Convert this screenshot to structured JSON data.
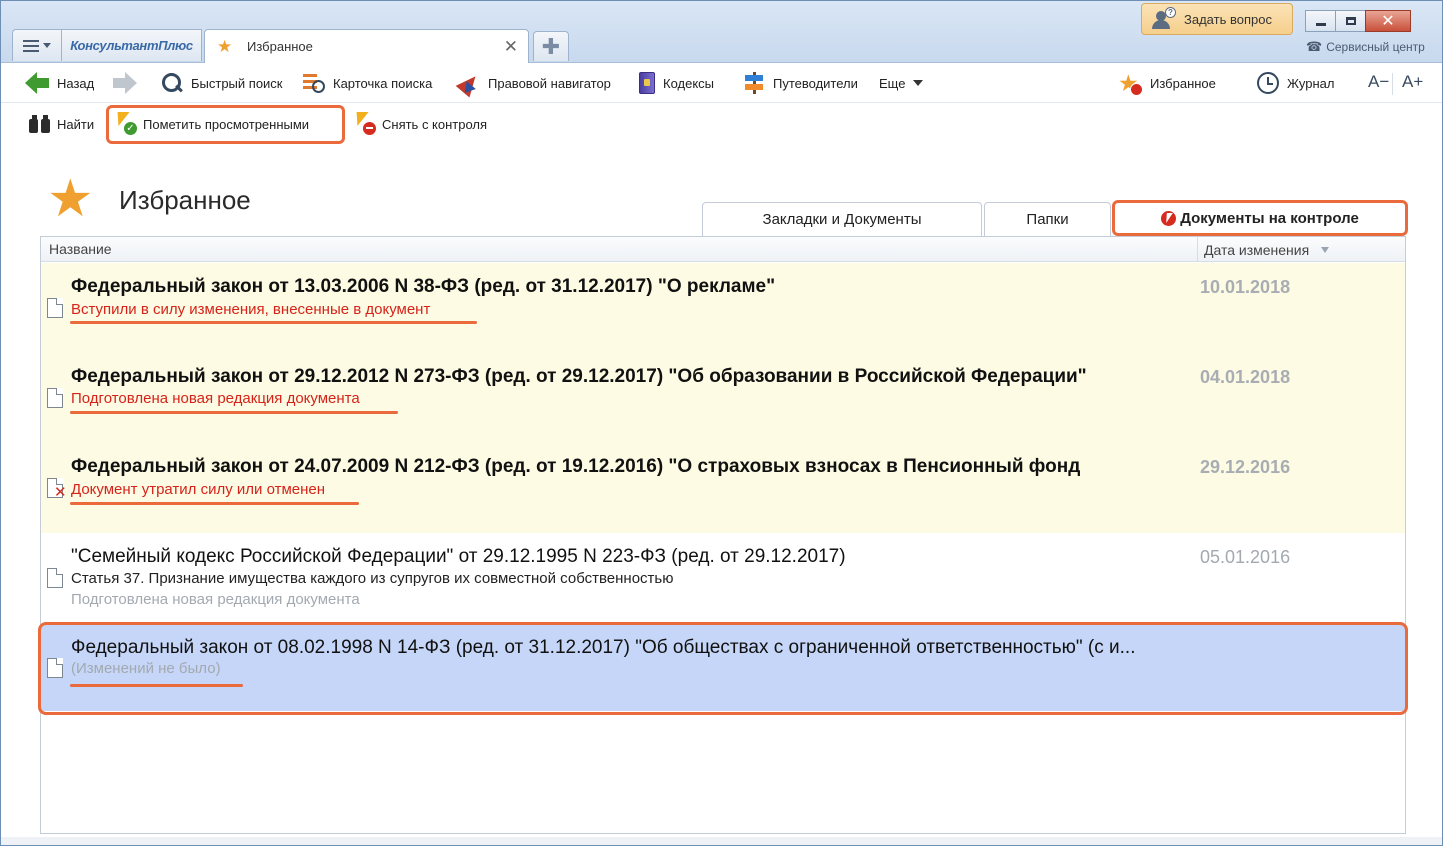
{
  "window": {
    "brand": "КонсультантПлюс",
    "ask_label": "Задать вопрос",
    "service_center": "Сервисный центр",
    "close_symbol": "✕"
  },
  "tab": {
    "title": "Избранное",
    "close_symbol": "✕",
    "new_symbol": "✚"
  },
  "toolbar": {
    "back": "Назад",
    "quick_search": "Быстрый поиск",
    "card_search": "Карточка поиска",
    "navigator": "Правовой навигатор",
    "codes": "Кодексы",
    "guides": "Путеводители",
    "more": "Еще",
    "favorites": "Избранное",
    "history": "Журнал",
    "font_smaller": "A−",
    "font_larger": "A+"
  },
  "subtoolbar": {
    "find": "Найти",
    "mark_viewed": "Пометить просмотренными",
    "remove_control": "Снять с контроля"
  },
  "page": {
    "title": "Избранное"
  },
  "view_tabs": [
    {
      "label": "Закладки и Документы"
    },
    {
      "label": "Папки"
    },
    {
      "label": "Документы на контроле"
    }
  ],
  "table": {
    "col_name": "Название",
    "col_date": "Дата изменения",
    "rows": [
      {
        "title": "Федеральный закон от 13.03.2006 N 38-ФЗ (ред. от 31.12.2017) \"О рекламе\"",
        "status": "Вступили в силу изменения, внесенные в документ",
        "date": "10.01.2018"
      },
      {
        "title": "Федеральный закон от 29.12.2012 N 273-ФЗ (ред. от 29.12.2017) \"Об образовании в Российской Федерации\"",
        "status": "Подготовлена новая редакция документа",
        "date": "04.01.2018"
      },
      {
        "title": "Федеральный закон от 24.07.2009 N 212-ФЗ (ред. от 19.12.2016) \"О страховых взносах в Пенсионный фонд",
        "status": "Документ утратил силу или отменен",
        "date": "29.12.2016"
      },
      {
        "title": "\"Семейный кодекс Российской Федерации\" от 29.12.1995 N 223-ФЗ (ред. от 29.12.2017)",
        "subtitle": "Статья 37. Признание имущества каждого из супругов их совместной собственностью",
        "status": "Подготовлена новая редакция документа",
        "date": "05.01.2016"
      },
      {
        "title": "Федеральный закон от 08.02.1998 N 14-ФЗ (ред. от 31.12.2017) \"Об обществах с ограниченной ответственностью\" (с и...",
        "status": "(Изменений не было)",
        "date": ""
      }
    ]
  },
  "colors": {
    "accent_orange": "#ea6a3c",
    "changed_row_bg": "#fdfbe3",
    "selected_row_bg": "#c6d6f8",
    "status_red": "#d6231a"
  }
}
